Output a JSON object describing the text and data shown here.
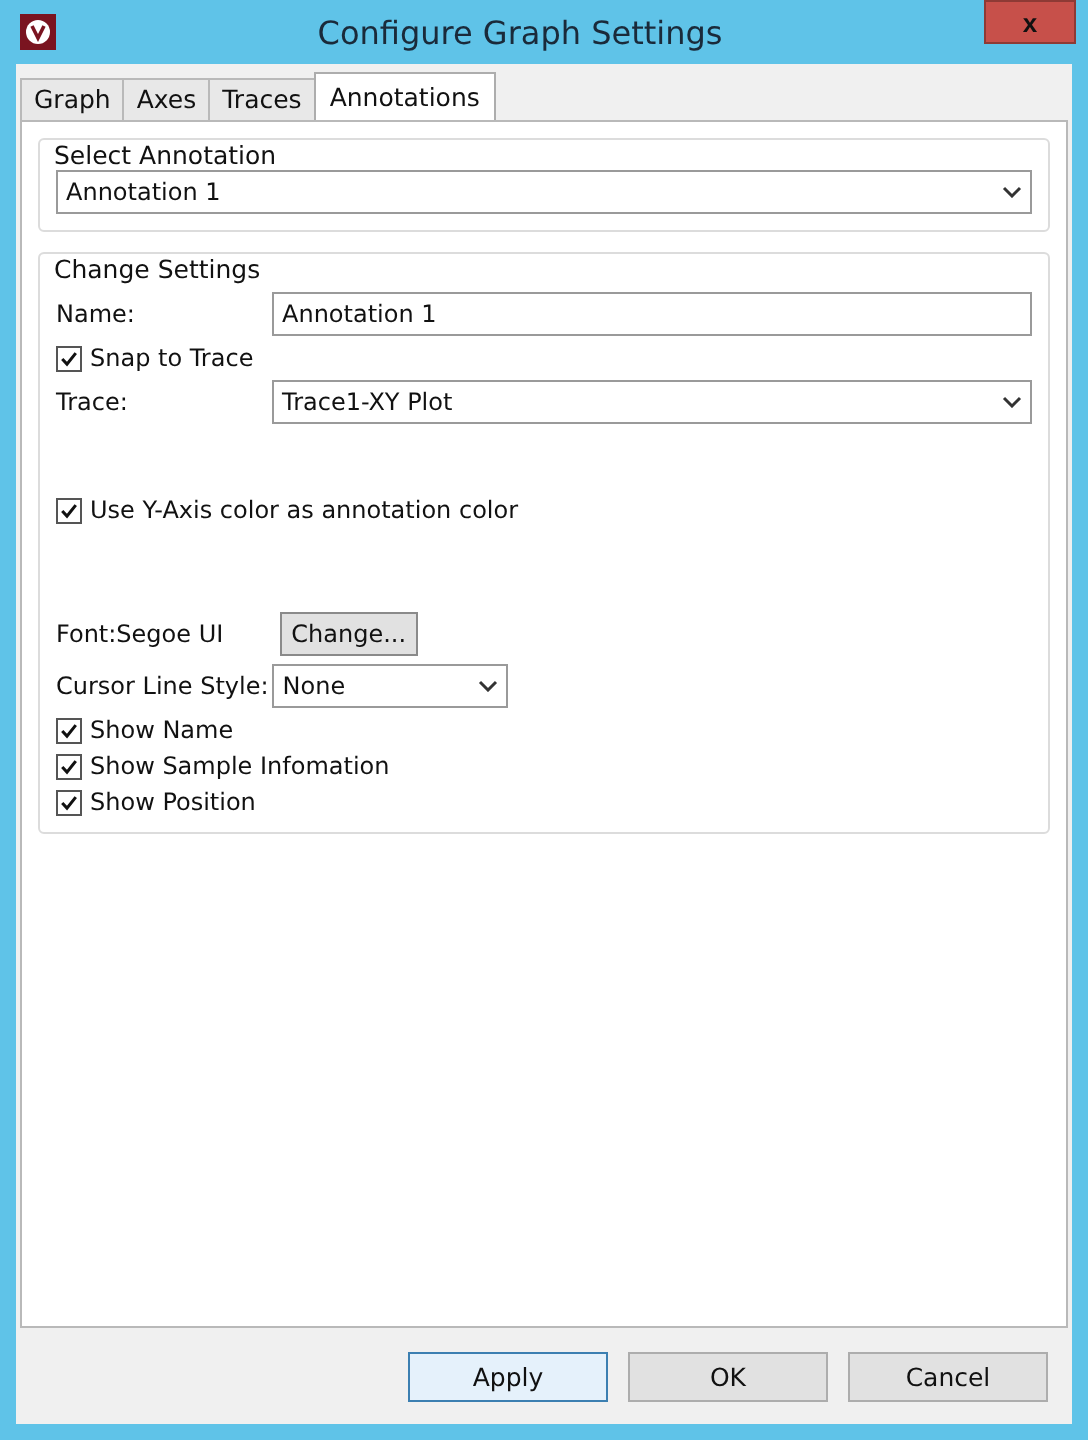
{
  "window": {
    "title": "Configure Graph Settings",
    "close": "x"
  },
  "tabs": [
    {
      "label": "Graph",
      "selected": false
    },
    {
      "label": "Axes",
      "selected": false
    },
    {
      "label": "Traces",
      "selected": false
    },
    {
      "label": "Annotations",
      "selected": true
    }
  ],
  "select_annotation": {
    "legend": "Select Annotation",
    "value": "Annotation 1"
  },
  "change_settings": {
    "legend": "Change Settings",
    "name": {
      "label": "Name:",
      "value": "Annotation 1"
    },
    "snap_to_trace": {
      "label": "Snap to Trace",
      "checked": true
    },
    "trace": {
      "label": "Trace:",
      "value": "Trace1-XY Plot"
    },
    "use_y_axis_color": {
      "label": "Use Y-Axis color as annotation color",
      "checked": true
    },
    "font": {
      "label": "Font:Segoe UI",
      "button": "Change..."
    },
    "cursor_line_style": {
      "label": "Cursor Line Style:",
      "value": "None"
    },
    "show_options": [
      {
        "label": "Show Name",
        "checked": true
      },
      {
        "label": "Show Sample Infomation",
        "checked": true
      },
      {
        "label": "Show Position",
        "checked": true
      }
    ]
  },
  "buttons": [
    {
      "label": "Apply",
      "default": true
    },
    {
      "label": "OK",
      "default": false
    },
    {
      "label": "Cancel",
      "default": false
    }
  ]
}
